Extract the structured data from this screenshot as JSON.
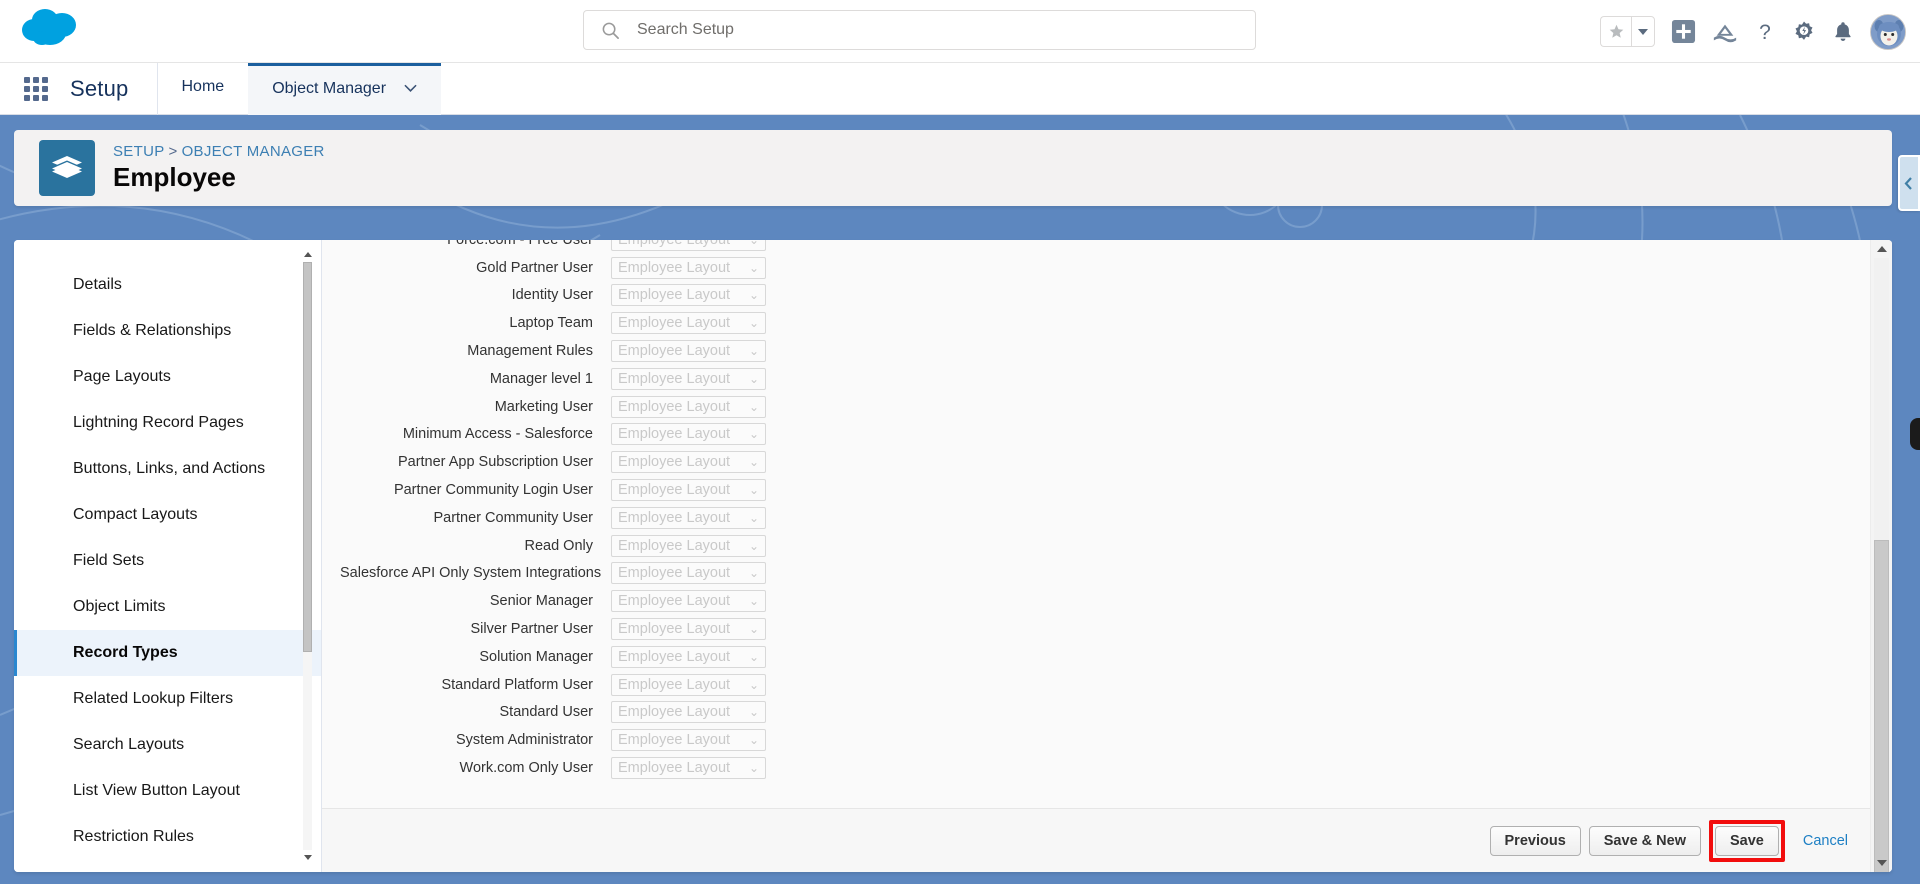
{
  "header": {
    "logo_icon": "salesforce-cloud-logo",
    "search": {
      "placeholder": "Search Setup",
      "value": "",
      "icon": "search-icon"
    },
    "icons": [
      {
        "name": "favorites-star-icon",
        "glyph": "star"
      },
      {
        "name": "favorites-caret-icon",
        "glyph": "caret-down"
      },
      {
        "name": "global-actions-plus-icon",
        "glyph": "plus-square"
      },
      {
        "name": "trailhead-icon",
        "glyph": "mountain"
      },
      {
        "name": "help-icon",
        "glyph": "question"
      },
      {
        "name": "setup-gear-icon",
        "glyph": "gear"
      },
      {
        "name": "notifications-bell-icon",
        "glyph": "bell"
      },
      {
        "name": "user-avatar",
        "glyph": "avatar"
      }
    ]
  },
  "setup_bar": {
    "app_launcher_icon": "app-launcher-waffle-icon",
    "title": "Setup",
    "tabs": [
      {
        "label": "Home",
        "active": false,
        "has_caret": false
      },
      {
        "label": "Object Manager",
        "active": true,
        "has_caret": true
      }
    ]
  },
  "record_header": {
    "object_icon": "layers-stack-icon",
    "breadcrumb": {
      "setup": "SETUP",
      "separator": ">",
      "object_manager": "OBJECT MANAGER"
    },
    "title": "Employee"
  },
  "sidebar": {
    "items": [
      {
        "label": "Details",
        "active": false
      },
      {
        "label": "Fields & Relationships",
        "active": false
      },
      {
        "label": "Page Layouts",
        "active": false
      },
      {
        "label": "Lightning Record Pages",
        "active": false
      },
      {
        "label": "Buttons, Links, and Actions",
        "active": false
      },
      {
        "label": "Compact Layouts",
        "active": false
      },
      {
        "label": "Field Sets",
        "active": false
      },
      {
        "label": "Object Limits",
        "active": false
      },
      {
        "label": "Record Types",
        "active": true
      },
      {
        "label": "Related Lookup Filters",
        "active": false
      },
      {
        "label": "Search Layouts",
        "active": false
      },
      {
        "label": "List View Button Layout",
        "active": false
      },
      {
        "label": "Restriction Rules",
        "active": false
      }
    ]
  },
  "assignment_table": {
    "layout_option_label": "Employee Layout",
    "select_caret_icon": "chevron-down-icon",
    "rows": [
      {
        "profile": "Force.com - Free User",
        "layout": "Employee Layout",
        "clipped": true
      },
      {
        "profile": "Gold Partner User",
        "layout": "Employee Layout"
      },
      {
        "profile": "Identity User",
        "layout": "Employee Layout"
      },
      {
        "profile": "Laptop Team",
        "layout": "Employee Layout"
      },
      {
        "profile": "Management Rules",
        "layout": "Employee Layout"
      },
      {
        "profile": "Manager level 1",
        "layout": "Employee Layout"
      },
      {
        "profile": "Marketing User",
        "layout": "Employee Layout"
      },
      {
        "profile": "Minimum Access - Salesforce",
        "layout": "Employee Layout"
      },
      {
        "profile": "Partner App Subscription User",
        "layout": "Employee Layout"
      },
      {
        "profile": "Partner Community Login User",
        "layout": "Employee Layout"
      },
      {
        "profile": "Partner Community User",
        "layout": "Employee Layout"
      },
      {
        "profile": "Read Only",
        "layout": "Employee Layout"
      },
      {
        "profile": "Salesforce API Only System Integrations",
        "layout": "Employee Layout"
      },
      {
        "profile": "Senior Manager",
        "layout": "Employee Layout"
      },
      {
        "profile": "Silver Partner User",
        "layout": "Employee Layout"
      },
      {
        "profile": "Solution Manager",
        "layout": "Employee Layout"
      },
      {
        "profile": "Standard Platform User",
        "layout": "Employee Layout"
      },
      {
        "profile": "Standard User",
        "layout": "Employee Layout"
      },
      {
        "profile": "System Administrator",
        "layout": "Employee Layout"
      },
      {
        "profile": "Work.com Only User",
        "layout": "Employee Layout"
      }
    ]
  },
  "footer": {
    "previous_label": "Previous",
    "save_and_new_label": "Save & New",
    "save_label": "Save",
    "cancel_label": "Cancel",
    "highlight_color": "#f20d0d",
    "highlighted_button": "Save"
  },
  "colors": {
    "brand_blue": "#5d87bf",
    "cloud_blue": "#00a1e0",
    "link_blue": "#1d7fc4",
    "object_icon_blue": "#2a739e",
    "active_nav_blue": "#2a87d0",
    "active_nav_bg": "#ecf3fb"
  }
}
